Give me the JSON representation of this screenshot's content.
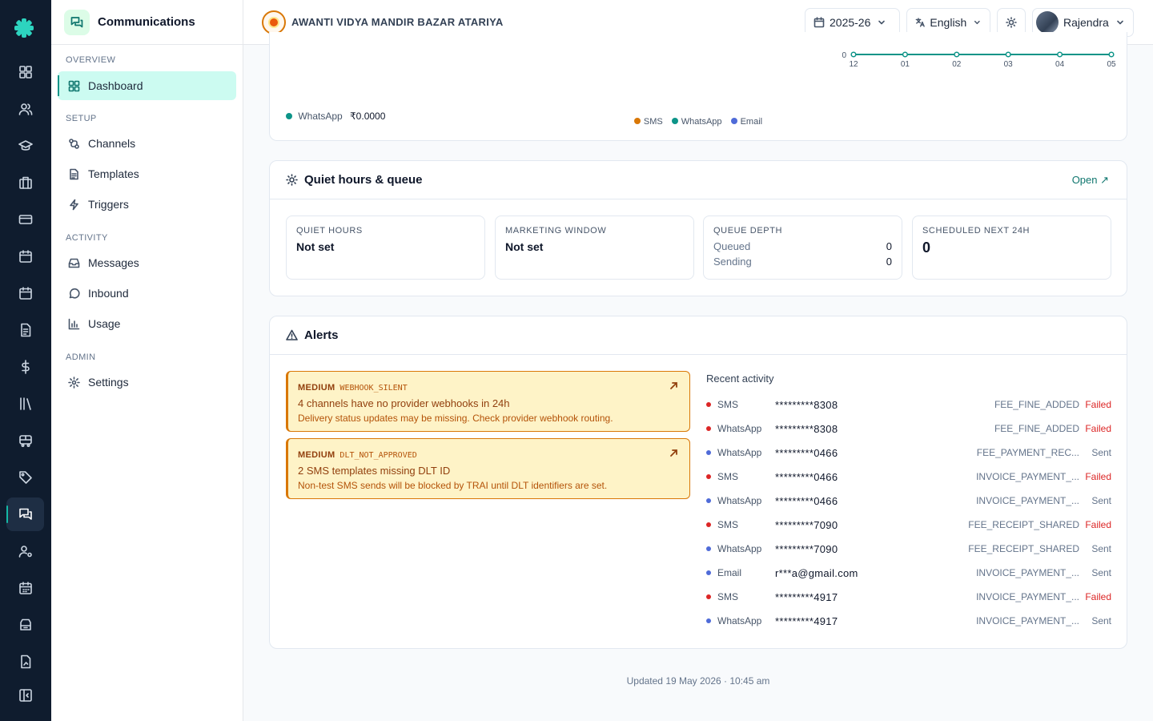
{
  "sidebar": {
    "title": "Communications",
    "sections": {
      "overview": "OVERVIEW",
      "setup": "SETUP",
      "activity": "ACTIVITY",
      "admin": "ADMIN"
    },
    "items": {
      "dashboard": "Dashboard",
      "channels": "Channels",
      "templates": "Templates",
      "triggers": "Triggers",
      "messages": "Messages",
      "inbound": "Inbound",
      "usage": "Usage",
      "settings": "Settings"
    }
  },
  "topbar": {
    "school_name": "AWANTI VIDYA MANDIR BAZAR ATARIYA",
    "year": "2025-26",
    "language": "English",
    "user": "Rajendra"
  },
  "usage_chart": {
    "chart_data": {
      "type": "line",
      "x": [
        "12",
        "01",
        "02",
        "03",
        "04",
        "05"
      ],
      "series": [
        {
          "name": "WhatsApp",
          "values": [
            0,
            0,
            0,
            0,
            0,
            0
          ]
        }
      ],
      "y_tick": "0",
      "legend": [
        "SMS",
        "WhatsApp",
        "Email"
      ]
    },
    "spend_label": "WhatsApp",
    "spend_value": "₹0.0000",
    "colors": {
      "sms": "#d97706",
      "whatsapp": "#0d9488",
      "email": "#4f6bd8"
    }
  },
  "quiet": {
    "title": "Quiet hours & queue",
    "open_link": "Open ↗",
    "quiet_hours": {
      "label": "QUIET HOURS",
      "value": "Not set"
    },
    "marketing": {
      "label": "MARKETING WINDOW",
      "value": "Not set"
    },
    "queue": {
      "label": "QUEUE DEPTH",
      "queued_label": "Queued",
      "queued_value": "0",
      "sending_label": "Sending",
      "sending_value": "0"
    },
    "scheduled": {
      "label": "SCHEDULED NEXT 24H",
      "value": "0"
    }
  },
  "alerts": {
    "title": "Alerts",
    "items": [
      {
        "severity": "MEDIUM",
        "code": "WEBHOOK_SILENT",
        "title": "4 channels have no provider webhooks in 24h",
        "desc": "Delivery status updates may be missing. Check provider webhook routing."
      },
      {
        "severity": "MEDIUM",
        "code": "DLT_NOT_APPROVED",
        "title": "2 SMS templates missing DLT ID",
        "desc": "Non-test SMS sends will be blocked by TRAI until DLT identifiers are set."
      }
    ]
  },
  "activity": {
    "title": "Recent activity",
    "rows": [
      {
        "channel": "SMS",
        "recipient": "*********8308",
        "event": "FEE_FINE_ADDED",
        "status": "Failed"
      },
      {
        "channel": "WhatsApp",
        "recipient": "*********8308",
        "event": "FEE_FINE_ADDED",
        "status": "Failed"
      },
      {
        "channel": "WhatsApp",
        "recipient": "*********0466",
        "event": "FEE_PAYMENT_REC...",
        "status": "Sent"
      },
      {
        "channel": "SMS",
        "recipient": "*********0466",
        "event": "INVOICE_PAYMENT_...",
        "status": "Failed"
      },
      {
        "channel": "WhatsApp",
        "recipient": "*********0466",
        "event": "INVOICE_PAYMENT_...",
        "status": "Sent"
      },
      {
        "channel": "SMS",
        "recipient": "*********7090",
        "event": "FEE_RECEIPT_SHARED",
        "status": "Failed"
      },
      {
        "channel": "WhatsApp",
        "recipient": "*********7090",
        "event": "FEE_RECEIPT_SHARED",
        "status": "Sent"
      },
      {
        "channel": "Email",
        "recipient": "r***a@gmail.com",
        "event": "INVOICE_PAYMENT_...",
        "status": "Sent"
      },
      {
        "channel": "SMS",
        "recipient": "*********4917",
        "event": "INVOICE_PAYMENT_...",
        "status": "Failed"
      },
      {
        "channel": "WhatsApp",
        "recipient": "*********4917",
        "event": "INVOICE_PAYMENT_...",
        "status": "Sent"
      }
    ],
    "colors": {
      "failed_dot": "#dc2626",
      "sent_dot": "#4f6bd8",
      "failed_text": "#dc2626"
    }
  },
  "footer": {
    "updated": "Updated 19 May 2026 · 10:45 am"
  }
}
